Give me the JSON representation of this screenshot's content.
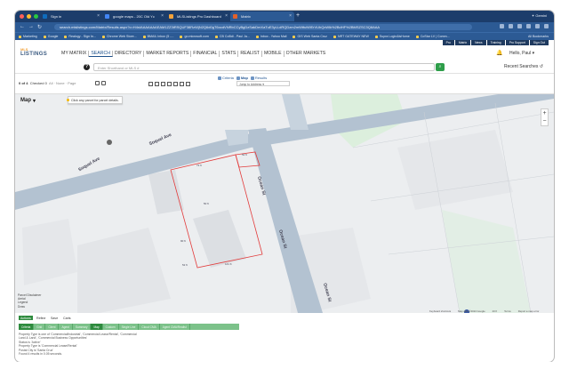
{
  "browser": {
    "tabs": [
      {
        "title": "Sign in",
        "color": "#0f6cbd",
        "active": false
      },
      {
        "title": "google maps - 20C Old Yc",
        "color": "#4285f4",
        "active": false
      },
      {
        "title": "MLSListings Pro Dashboard",
        "color": "#f2a23b",
        "active": false
      },
      {
        "title": "Matrix",
        "color": "#e0612b",
        "active": true
      }
    ],
    "new_tab": "+",
    "profile_label": "Gemini",
    "url": "search.mlslistings.com/Matrix/Results.aspx?c=H4sIAAAAAAAEAM1ZZ3tRSQUF38RzWjN2Q6d0gT6ocdVNRbCCyBgDzSakDmXaTuE3yLLdRQDzm2mWtfuN9ErVUhQxWlk%2BdHF%2BMSZSC3Q8AAA",
    "bookmarks": [
      "Marketing",
      "Google",
      "Realogy - Sign In...",
      "Chrome Web Store...",
      "BMAIL Inbox (5 -...",
      "go.microsoft.com",
      "CB CoBdi - Paul Ja...",
      "Inbox - Yahoo Mail",
      "GIS Web Santa Cruz",
      "NRT GATEWAY NEW",
      "Supra Login&lsHome",
      "CoStar LV | Comm..."
    ],
    "bookmarks_right": "All Bookmarks"
  },
  "app": {
    "logo_top": "MLS",
    "logo_bottom": "LISTINGS",
    "top_links": [
      "Pro",
      "Matrix",
      "News",
      "Training",
      "Pro Support",
      "Sign Out"
    ],
    "nav": [
      {
        "label": "MY MATRIX",
        "active": false
      },
      {
        "label": "SEARCH",
        "active": true
      },
      {
        "label": "DIRECTORY",
        "active": false
      },
      {
        "label": "MARKET REPORTS",
        "active": false
      },
      {
        "label": "FINANCIAL",
        "active": false
      },
      {
        "label": "STATS",
        "active": false
      },
      {
        "label": "REALIST",
        "active": false
      },
      {
        "label": "MOBILE",
        "active": false
      },
      {
        "label": "OTHER MARKETS",
        "active": false
      }
    ],
    "greeting": "Hello, Paul",
    "search_placeholder": "Enter Shorthand or MLS #",
    "recent_searches": "Recent Searches"
  },
  "results": {
    "view_tabs": [
      "Criteria",
      "Map",
      "Results"
    ],
    "count_label": "0 of 4",
    "checked_label": "Checked 0",
    "selection_links": "All · None · Page",
    "jump_placeholder": "Jump to Address"
  },
  "map": {
    "title": "Map",
    "tooltip": "Click any parcel for parcel details.",
    "zoom_in": "+",
    "zoom_out": "−",
    "roads": [
      "Soquel Ave",
      "Soquel Ave",
      "Ocean St",
      "Ocean St",
      "Ocean St"
    ],
    "parcel_labels": [
      "72 ft",
      "52 ft",
      "50 ft",
      "90 ft",
      "52 ft",
      "141 ft"
    ],
    "legend": [
      "Parcel Disclaimer",
      "Aerial",
      "Legend",
      "Draw"
    ],
    "footer": [
      "Keyboard shortcuts",
      "Map data ©2024 Google",
      "20 ft",
      "Terms",
      "Report a map error"
    ],
    "colors": {
      "road": "#b3c2d1",
      "parcel": "#e23b3b",
      "land": "#eceef0",
      "building": "#dfe1e4",
      "green": "#dcefdd"
    }
  },
  "actions": {
    "buttons": [
      "Actions",
      "Refine",
      "Save",
      "Carts"
    ],
    "displays": [
      "Criteria",
      "Grid",
      "Client",
      "Agent",
      "Summary",
      "Map",
      "Custom",
      "Single Line",
      "Cloud CMA",
      "Agent CMA/Realist"
    ],
    "criteria_lines": [
      "Property Type is one of 'Commercial/Industrial', 'Commercial Lease/Rental', 'Commercial",
      "Land & Land', 'Commercial Business Opportunities'",
      "Status is 'Active'",
      "Property Type is 'Commercial Lease/Rental'",
      "Postal City is 'Santa Cruz'",
      "Found 4 results in 0.05 seconds."
    ]
  },
  "colors": {
    "tabbar": "#1c3d6b",
    "addrbar": "#2c5a94",
    "accent": "#1b4f8a",
    "green": "#2e9e4a"
  }
}
